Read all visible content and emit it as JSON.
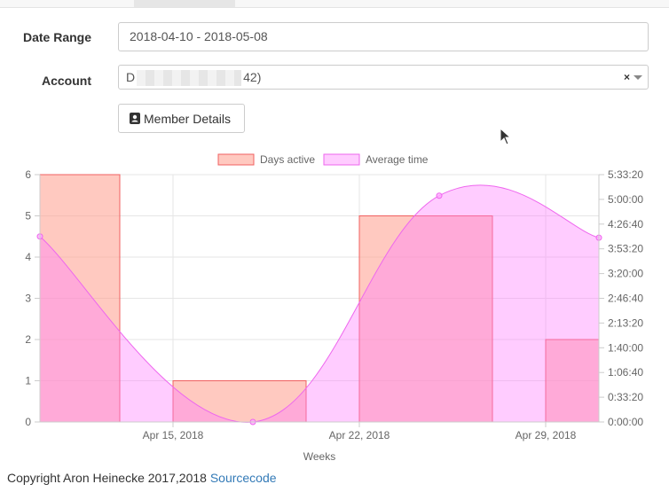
{
  "form": {
    "date_range_label": "Date Range",
    "date_range_value": "2018-04-10 - 2018-05-08",
    "account_label": "Account",
    "account_value_prefix": "D",
    "account_value_suffix": "42)",
    "account_clear": "×",
    "member_details_label": "Member Details"
  },
  "icons": {
    "member": "address-card-icon",
    "clear": "clear-icon",
    "caret": "chevron-down-icon",
    "cursor": "mouse-cursor-icon"
  },
  "chart_data": {
    "type": "bar",
    "x_axis": {
      "label": "Weeks",
      "ticks": [
        "Apr 15, 2018",
        "Apr 22, 2018",
        "Apr 29, 2018"
      ]
    },
    "y_left": {
      "ylim": [
        0,
        6
      ],
      "ticks": [
        "0",
        "1",
        "2",
        "3",
        "4",
        "5",
        "6"
      ]
    },
    "y_right": {
      "ylim": [
        0,
        20000
      ],
      "ticks": [
        "0:00:00",
        "0:33:20",
        "1:06:40",
        "1:40:00",
        "2:13:20",
        "2:46:40",
        "3:20:00",
        "3:53:20",
        "4:26:40",
        "5:00:00",
        "5:33:20"
      ]
    },
    "legend": {
      "placement": "top-center",
      "entries": [
        "Days active",
        "Average time"
      ]
    },
    "series": [
      {
        "name": "Days active",
        "type": "bar",
        "color": "#ff9c8c",
        "bars": [
          {
            "start": "2018-04-10",
            "end": "2018-04-13",
            "value": 6
          },
          {
            "start": "2018-04-15",
            "end": "2018-04-20",
            "value": 1
          },
          {
            "start": "2018-04-22",
            "end": "2018-04-27",
            "value": 5
          },
          {
            "start": "2018-04-29",
            "end": "2018-05-01",
            "value": 2
          }
        ]
      },
      {
        "name": "Average time",
        "type": "area",
        "color": "#ee66ee",
        "points": [
          {
            "x": "2018-04-10",
            "y": 15000
          },
          {
            "x": "2018-04-18",
            "y": 0
          },
          {
            "x": "2018-04-25",
            "y": 18300
          },
          {
            "x": "2018-05-01",
            "y": 14900
          }
        ]
      }
    ],
    "grid": true
  },
  "footer": {
    "copyright": "Copyright Aron Heinecke 2017,2018",
    "link": "Sourcecode"
  }
}
